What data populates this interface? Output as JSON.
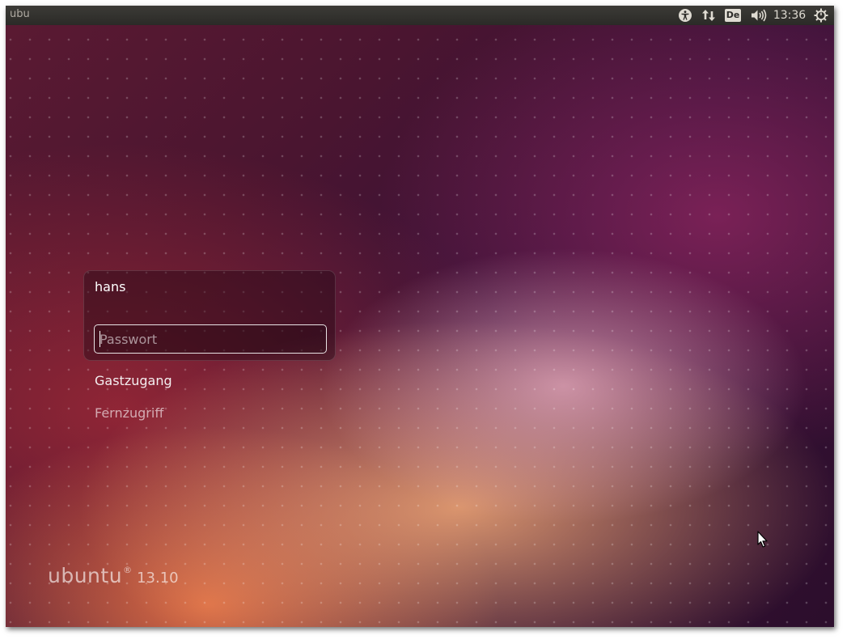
{
  "panel": {
    "hostname": "ubu",
    "keyboard_layout": "De",
    "clock": "13:36",
    "icons": {
      "accessibility": "accessibility-icon",
      "network": "network-updown-icon",
      "volume": "volume-icon",
      "power": "power-gear-icon"
    }
  },
  "greeter": {
    "user_name": "hans",
    "password_placeholder": "Passwort",
    "password_value": "",
    "guest_label": "Gastzugang",
    "remote_label": "Fernzugriff"
  },
  "branding": {
    "logo_text": "ubuntu",
    "logo_mark": "®",
    "version": "13.10"
  },
  "colors": {
    "panel_bg": "#2b2a27",
    "panel_text": "#dfdbd2",
    "wallpaper_dark": "#3a1238",
    "wallpaper_orange": "#f6ac78"
  }
}
